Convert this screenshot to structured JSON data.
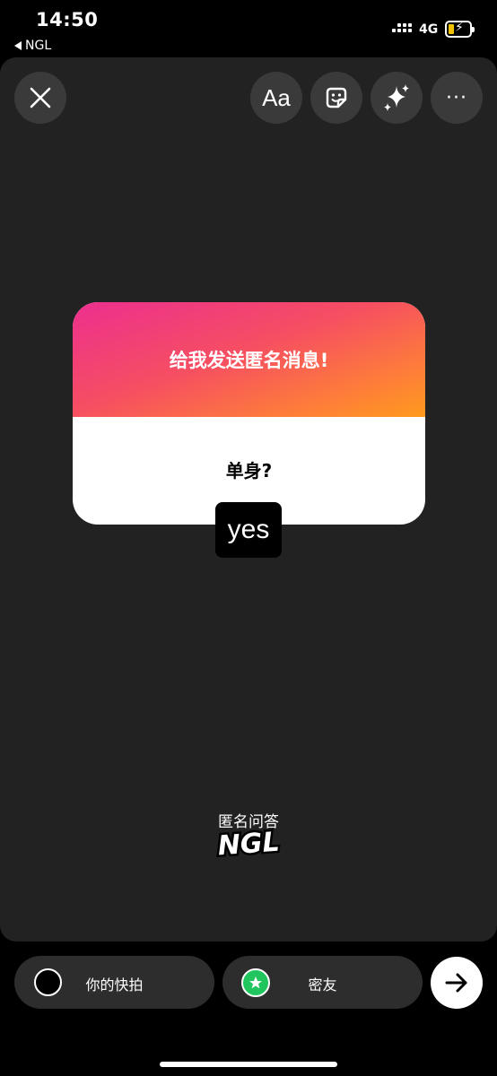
{
  "status_bar": {
    "time": "14:50",
    "back_app": "NGL",
    "network": "4G",
    "battery_color": "#f2c200"
  },
  "toolbar": {
    "close_icon": "close-icon",
    "text_label": "Aa",
    "sticker_icon": "sticker-icon",
    "effects_icon": "sparkles-icon",
    "more_label": "···"
  },
  "card": {
    "title": "给我发送匿名消息!",
    "question": "单身?",
    "gradient_colors": [
      "#ec2f8f",
      "#f64e62",
      "#fe7f38",
      "#ff9a1c"
    ]
  },
  "answer": {
    "text": "yes"
  },
  "branding": {
    "logo_text": "NGL",
    "subtitle": "匿名问答"
  },
  "share": {
    "story_label": "你的快拍",
    "friends_label": "密友",
    "friends_badge_color": "#21c55d",
    "next_icon": "arrow-right-icon"
  }
}
